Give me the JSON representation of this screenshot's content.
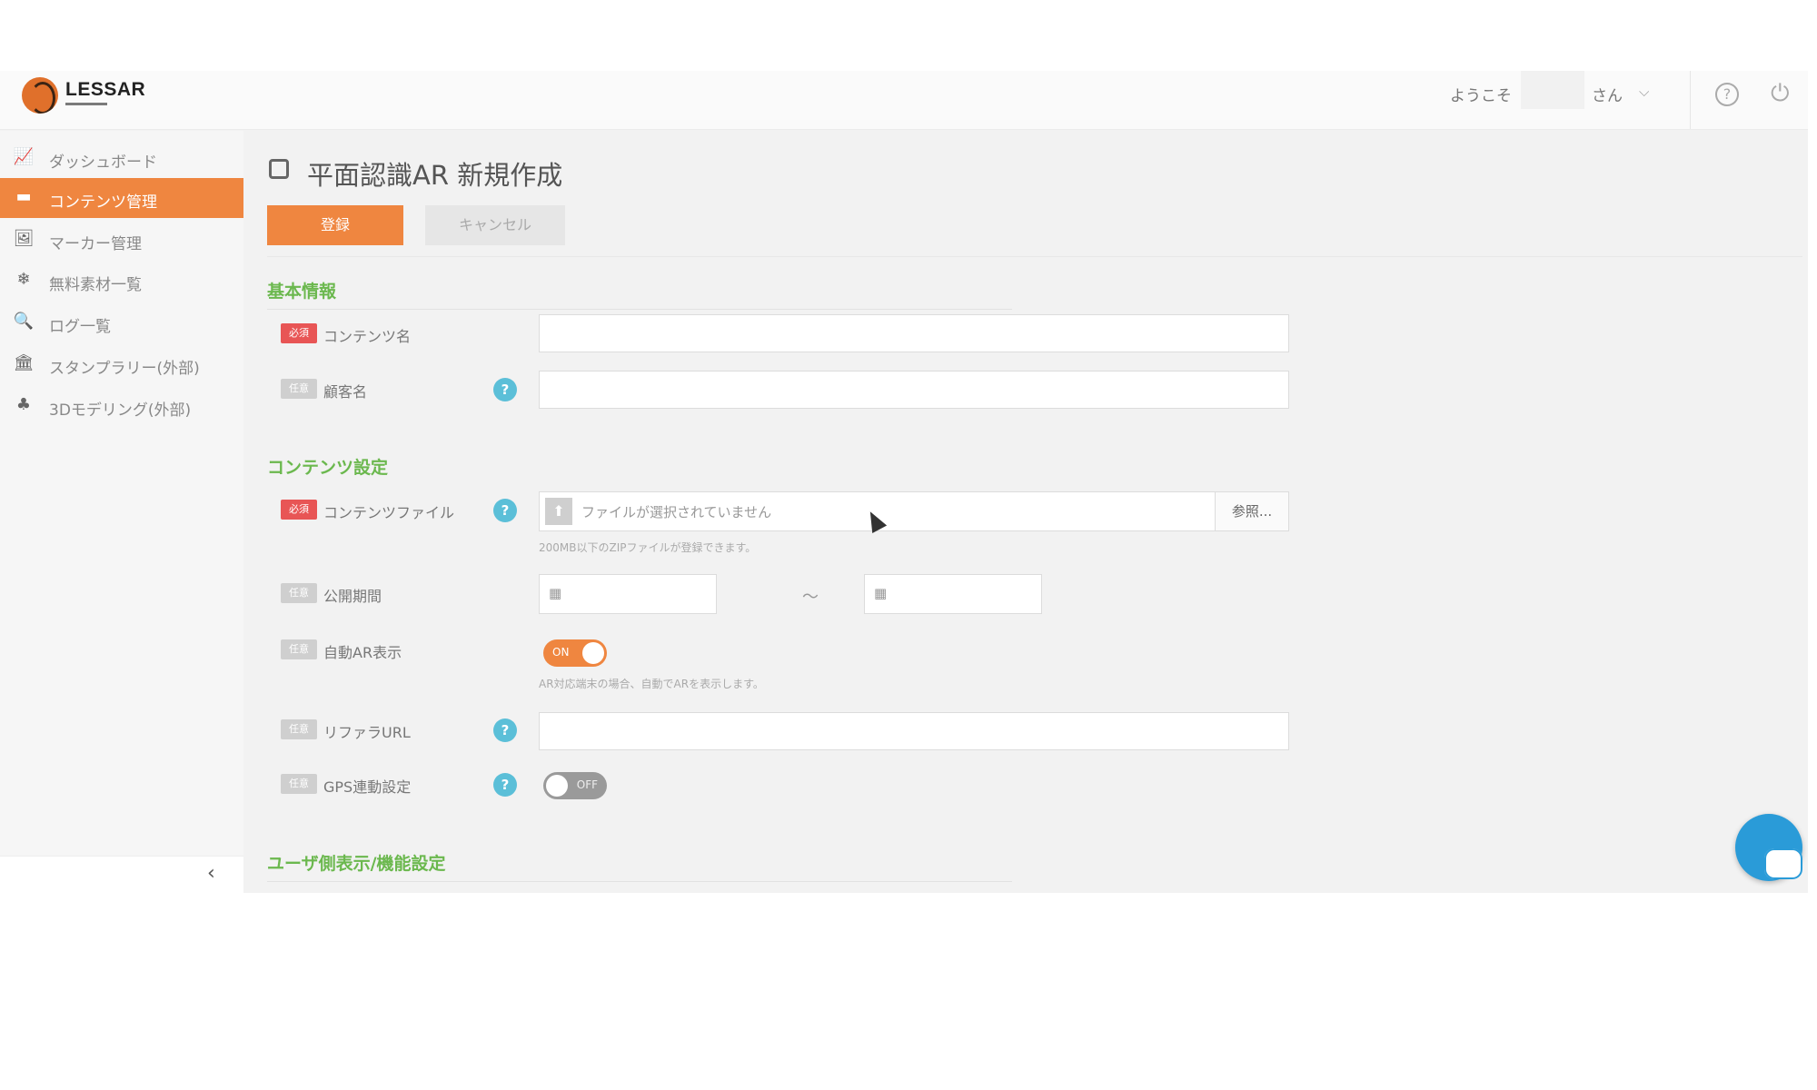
{
  "header": {
    "logo_text": "LESSAR",
    "welcome": "ようこそ",
    "san": "さん",
    "chevron": "⌵",
    "help": "?",
    "power": "⏻"
  },
  "sidebar": {
    "items": [
      {
        "icon": "chart-icon",
        "glyph": "📈",
        "label": "ダッシュボード",
        "active": false
      },
      {
        "icon": "box-icon",
        "glyph": "▬",
        "label": "コンテンツ管理",
        "active": true
      },
      {
        "icon": "image-icon",
        "glyph": "🖼",
        "label": "マーカー管理",
        "active": false
      },
      {
        "icon": "snowflake-icon",
        "glyph": "❄",
        "label": "無料素材一覧",
        "active": false
      },
      {
        "icon": "log-search-icon",
        "glyph": "🔍",
        "label": "ログ一覧",
        "active": false
      },
      {
        "icon": "stamp-icon",
        "glyph": "🏛",
        "label": "スタンプラリー(外部)",
        "active": false
      },
      {
        "icon": "model-icon",
        "glyph": "♣",
        "label": "3Dモデリング(外部)",
        "active": false
      }
    ],
    "collapse_glyph": "‹"
  },
  "page": {
    "title": "平面認識AR 新規作成",
    "register_label": "登録",
    "cancel_label": "キャンセル"
  },
  "sections": {
    "basic": "基本情報",
    "content": "コンテンツ設定",
    "user": "ユーザ側表示/機能設定"
  },
  "badges": {
    "required": "必須",
    "optional": "任意"
  },
  "fields": {
    "content_name": "コンテンツ名",
    "client_name": "顧客名",
    "content_file": "コンテンツファイル",
    "file_placeholder": "ファイルが選択されていません",
    "browse_label": "参照...",
    "file_hint": "200MB以下のZIPファイルが登録できます。",
    "publish_period": "公開期間",
    "date_icon": "▦",
    "tilde": "〜",
    "auto_ar": "自動AR表示",
    "auto_ar_state": "ON",
    "auto_ar_hint": "AR対応端末の場合、自動でARを表示します。",
    "referer_url": "リファラURL",
    "gps": "GPS連動設定",
    "gps_state": "OFF",
    "help_glyph": "?",
    "upload_glyph": "⬆"
  },
  "colors": {
    "accent": "#ef8640",
    "section": "#6bb84e",
    "help": "#5bbfd8",
    "required": "#e85555"
  }
}
